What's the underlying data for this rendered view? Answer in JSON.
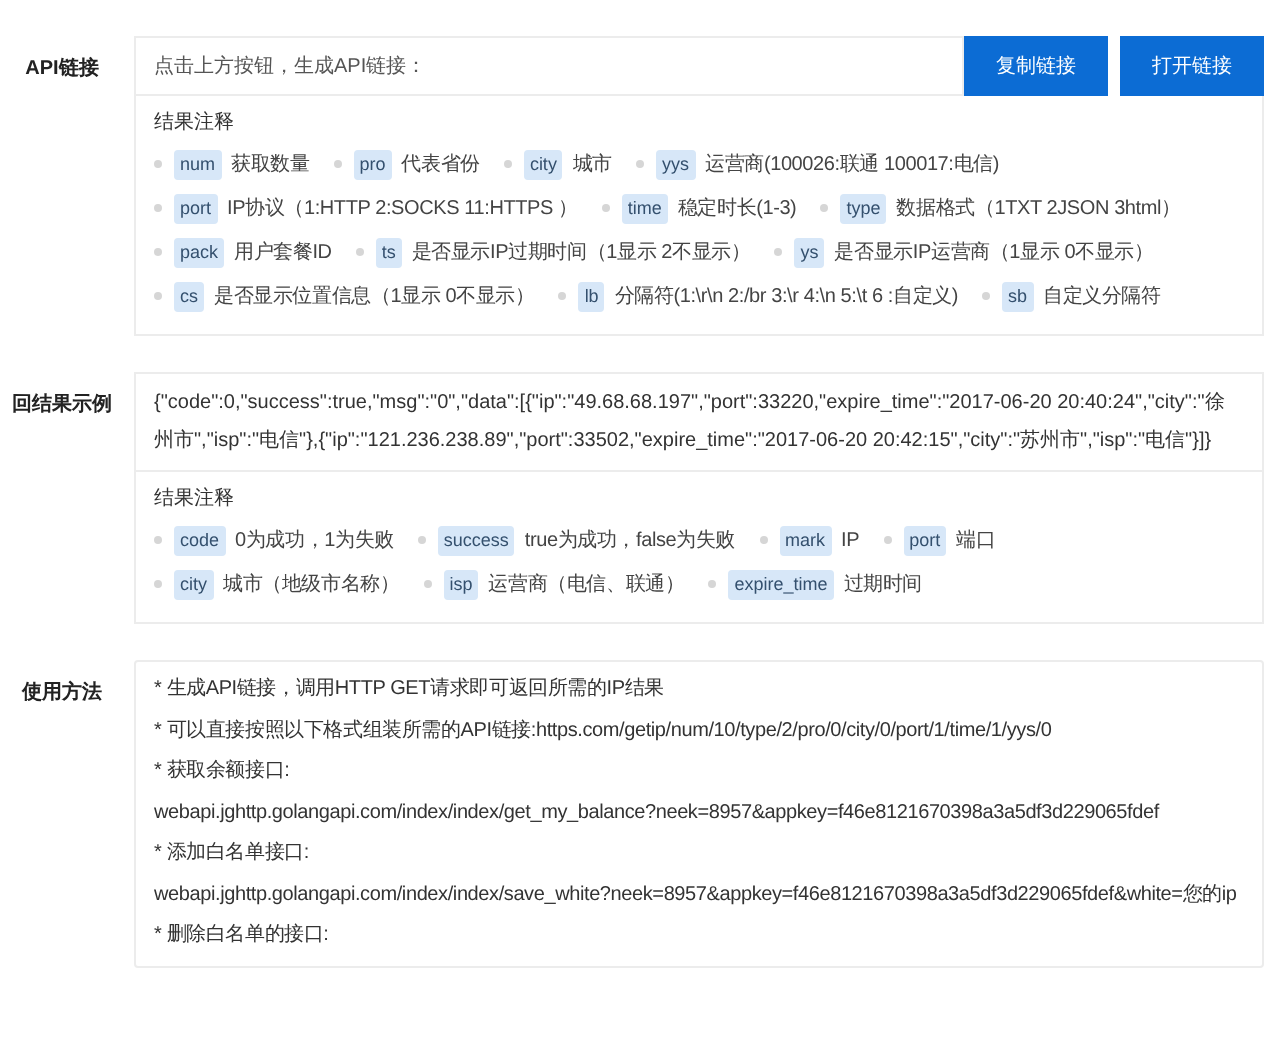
{
  "sections": [
    {
      "kind": "generator",
      "label": "API链接",
      "link_field": {
        "placeholder": "点击上方按钮，生成API链接："
      },
      "buttons": [
        "复制链接",
        "打开链接"
      ],
      "notes": {
        "title": "结果注释",
        "lines": [
          [
            {
              "key": "num",
              "desc": "获取数量"
            },
            {
              "key": "pro",
              "desc": "代表省份"
            },
            {
              "key": "city",
              "desc": "城市"
            },
            {
              "key": "yys",
              "desc": "运营商(100026:联通 100017:电信)"
            }
          ],
          [
            {
              "key": "port",
              "desc": "IP协议（1:HTTP 2:SOCKS 11:HTTPS ）"
            },
            {
              "key": "time",
              "desc": "稳定时长(1-3)"
            },
            {
              "key": "type",
              "desc": "数据格式（1TXT 2JSON 3html）"
            }
          ],
          [
            {
              "key": "pack",
              "desc": "用户套餐ID"
            },
            {
              "key": "ts",
              "desc": "是否显示IP过期时间（1显示 2不显示）"
            },
            {
              "key": "ys",
              "desc": "是否显示IP运营商（1显示 0不显示）"
            }
          ],
          [
            {
              "key": "cs",
              "desc": "是否显示位置信息（1显示 0不显示）"
            },
            {
              "key": "lb",
              "desc": "分隔符(1:\\r\\n 2:/br 3:\\r 4:\\n 5:\\t 6 :自定义)"
            },
            {
              "key": "sb",
              "desc": "自定义分隔符"
            }
          ]
        ]
      }
    },
    {
      "kind": "example",
      "label": "回结果示例",
      "example": "{\"code\":0,\"success\":true,\"msg\":\"0\",\"data\":[{\"ip\":\"49.68.68.197\",\"port\":33220,\"expire_time\":\"2017-06-20 20:40:24\",\"city\":\"徐州市\",\"isp\":\"电信\"},{\"ip\":\"121.236.238.89\",\"port\":33502,\"expire_time\":\"2017-06-20 20:42:15\",\"city\":\"苏州市\",\"isp\":\"电信\"}]}",
      "notes": {
        "title": "结果注释",
        "lines": [
          [
            {
              "key": "code",
              "desc": "0为成功，1为失败"
            },
            {
              "key": "success",
              "desc": "true为成功，false为失败"
            },
            {
              "key": "mark",
              "desc": "IP"
            },
            {
              "key": "port",
              "desc": "端口"
            }
          ],
          [
            {
              "key": "city",
              "desc": "城市（地级市名称）"
            },
            {
              "key": "isp",
              "desc": "运营商（电信、联通）"
            },
            {
              "key": "expire_time",
              "desc": "过期时间"
            }
          ]
        ]
      }
    },
    {
      "kind": "usage",
      "label": "使用方法",
      "lines": [
        "* 生成API链接，调用HTTP GET请求即可返回所需的IP结果",
        "* 可以直接按照以下格式组装所需的API链接:https.com/getip/num/10/type/2/pro/0/city/0/port/1/time/1/yys/0",
        "* 获取余额接口:",
        "webapi.jghttp.golangapi.com/index/index/get_my_balance?neek=8957&appkey=f46e8121670398a3a5df3d229065fdef",
        "* 添加白名单接口:",
        "webapi.jghttp.golangapi.com/index/index/save_white?neek=8957&appkey=f46e8121670398a3a5df3d229065fdef&white=您的ip",
        "* 删除白名单的接口:"
      ]
    }
  ]
}
